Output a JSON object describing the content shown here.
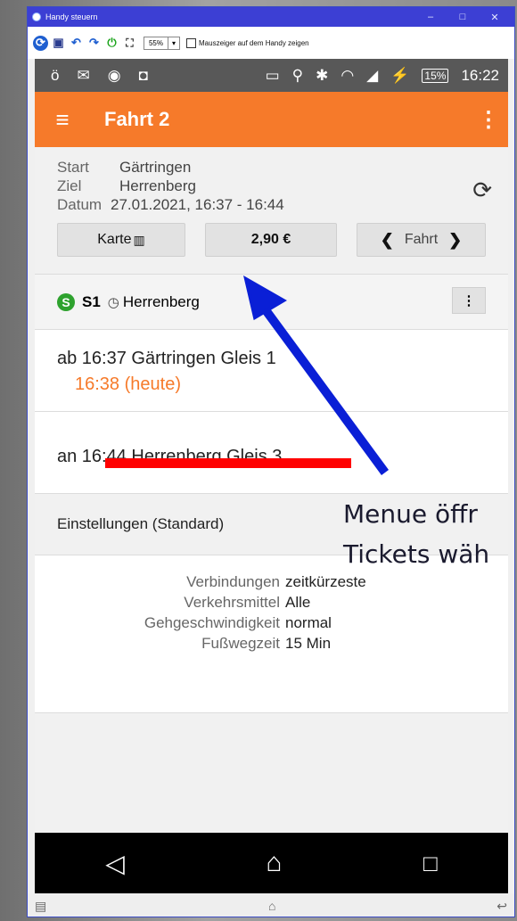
{
  "window": {
    "title": "Handy steuern",
    "controls": [
      "–",
      "□",
      "✕"
    ]
  },
  "toolbar": {
    "zoom_value": "55%",
    "checkbox_label": "Mauszeiger auf dem Handy zeigen",
    "checkbox_checked": false
  },
  "statusbar": {
    "battery": "15%",
    "time": "16:22"
  },
  "appbar": {
    "title": "Fahrt 2"
  },
  "trip": {
    "start_label": "Start",
    "start_value": "Gärtringen",
    "dest_label": "Ziel",
    "dest_value": "Herrenberg",
    "date_label": "Datum",
    "date_value": "27.01.2021, 16:37 - 16:44"
  },
  "buttons": {
    "map": "Karte",
    "price": "2,90 €",
    "trip_nav": "Fahrt"
  },
  "train": {
    "line": "S1",
    "direction": "Herrenberg"
  },
  "departure": {
    "text": "ab 16:37 Gärtringen Gleis 1",
    "realtime": "16:38 (heute)"
  },
  "arrival": {
    "text": "an 16:44 Herrenberg Gleis 3"
  },
  "settings": {
    "header": "Einstellungen (Standard)",
    "rows": [
      {
        "key": "Verbindungen",
        "value": "zeitkürzeste"
      },
      {
        "key": "Verkehrsmittel",
        "value": "Alle"
      },
      {
        "key": "Gehgeschwindigkeit",
        "value": "normal"
      },
      {
        "key": "Fußwegzeit",
        "value": "15 Min"
      }
    ]
  },
  "annotation": {
    "line1": "Menue öffr",
    "line2": "Tickets wäh",
    "arrow_color": "#0a1fd6",
    "underline_color": "#ff0000"
  },
  "colors": {
    "accent": "#f67a2a",
    "sbahn": "#2ea22e",
    "window_title": "#3c3fd4"
  }
}
